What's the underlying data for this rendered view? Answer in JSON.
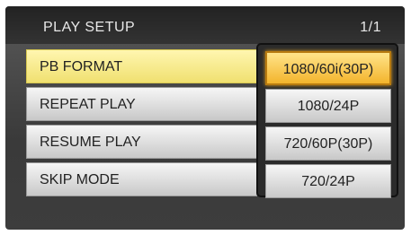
{
  "header": {
    "title": "PLAY SETUP",
    "page": "1/1"
  },
  "menu": {
    "items": [
      {
        "label": "PB FORMAT",
        "value": "1080/60i(30P)",
        "selected": true
      },
      {
        "label": "REPEAT PLAY",
        "value": "1080/24P",
        "selected": false
      },
      {
        "label": "RESUME PLAY",
        "value": "720/60P(30P)",
        "selected": false
      },
      {
        "label": "SKIP MODE",
        "value": "720/24P",
        "selected": false
      }
    ]
  },
  "colors": {
    "selected_item": "#f0e070",
    "selected_value": "#f3b42c",
    "background": "#3d3d3d"
  }
}
